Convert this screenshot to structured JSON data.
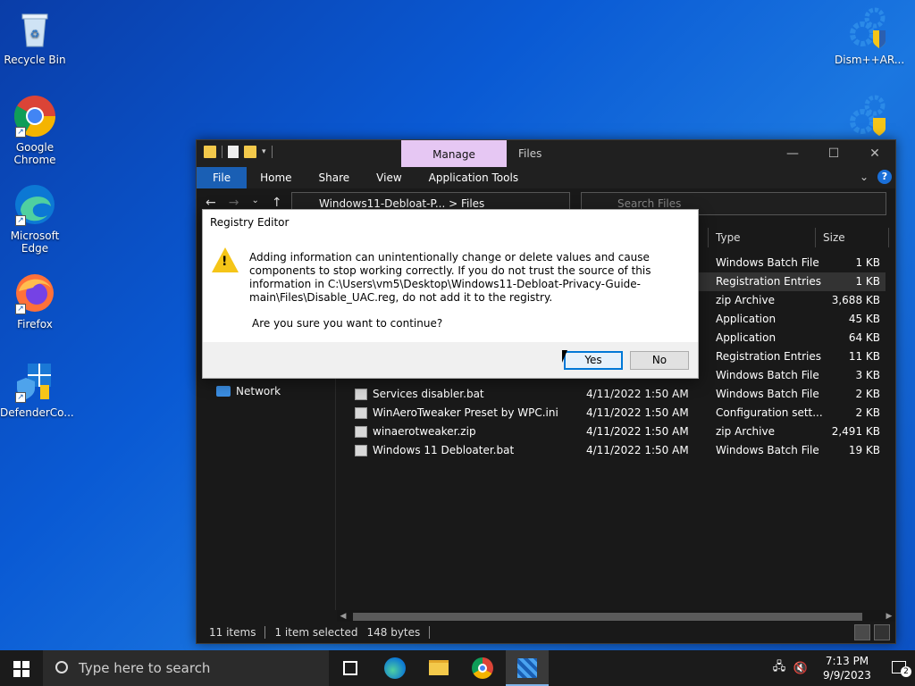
{
  "desktop": {
    "icons": [
      {
        "label": "Recycle Bin"
      },
      {
        "label": "Google Chrome"
      },
      {
        "label": "Microsoft Edge"
      },
      {
        "label": "Firefox"
      },
      {
        "label": "DefenderCo..."
      },
      {
        "label": "Dism++AR..."
      }
    ]
  },
  "explorer": {
    "title": "Files",
    "manage_tab": "Manage",
    "ribbon_tabs": [
      "File",
      "Home",
      "Share",
      "View",
      "Application Tools"
    ],
    "address": "Windows11-Debloat-P...  >  Files",
    "search_placeholder": "Search Files",
    "nav": {
      "network": "Network"
    },
    "columns": {
      "type": "Type",
      "size": "Size"
    },
    "rows": [
      {
        "name": "",
        "date": "",
        "type": "Windows Batch File",
        "size": "1 KB",
        "selected": false
      },
      {
        "name": "",
        "date": "",
        "type": "Registration Entries",
        "size": "1 KB",
        "selected": true
      },
      {
        "name": "",
        "date": "",
        "type": "zip Archive",
        "size": "3,688 KB",
        "selected": false
      },
      {
        "name": "",
        "date": "",
        "type": "Application",
        "size": "45 KB",
        "selected": false
      },
      {
        "name": "",
        "date": "",
        "type": "Application",
        "size": "64 KB",
        "selected": false
      },
      {
        "name": "",
        "date": "",
        "type": "Registration Entries",
        "size": "11 KB",
        "selected": false
      },
      {
        "name": "",
        "date": "",
        "type": "Windows Batch File",
        "size": "3 KB",
        "selected": false
      },
      {
        "name": "Services disabler.bat",
        "date": "4/11/2022 1:50 AM",
        "type": "Windows Batch File",
        "size": "2 KB",
        "selected": false
      },
      {
        "name": "WinAeroTweaker Preset by WPC.ini",
        "date": "4/11/2022 1:50 AM",
        "type": "Configuration sett...",
        "size": "2 KB",
        "selected": false
      },
      {
        "name": "winaerotweaker.zip",
        "date": "4/11/2022 1:50 AM",
        "type": "zip Archive",
        "size": "2,491 KB",
        "selected": false
      },
      {
        "name": "Windows 11 Debloater.bat",
        "date": "4/11/2022 1:50 AM",
        "type": "Windows Batch File",
        "size": "19 KB",
        "selected": false
      }
    ],
    "status": {
      "items": "11 items",
      "selected": "1 item selected",
      "bytes": "148 bytes"
    }
  },
  "dialog": {
    "title": "Registry Editor",
    "message": "Adding information can unintentionally change or delete values and cause components to stop working correctly. If you do not trust the source of this information in C:\\Users\\vm5\\Desktop\\Windows11-Debloat-Privacy-Guide-main\\Files\\Disable_UAC.reg, do not add it to the registry.",
    "question": "Are you sure you want to continue?",
    "yes_label": "Yes",
    "no_label": "No"
  },
  "taskbar": {
    "search_placeholder": "Type here to search",
    "time": "7:13 PM",
    "date": "9/9/2023",
    "notification_count": "2"
  },
  "colors": {
    "accent": "#1a5fb4",
    "manage_tab": "#e6c7f3",
    "warning": "#f5c518"
  }
}
